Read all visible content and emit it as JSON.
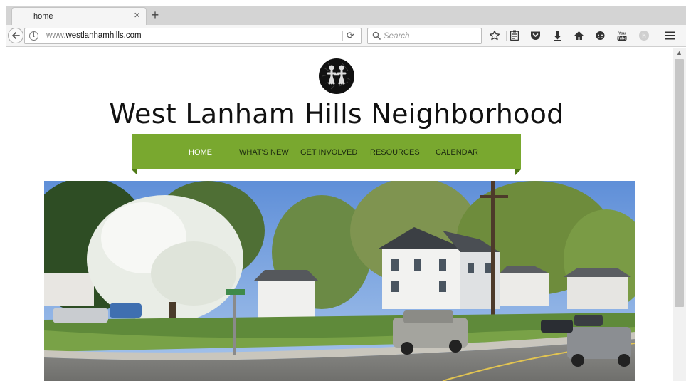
{
  "browser": {
    "tab": {
      "title": "home",
      "close": "×"
    },
    "new_tab": "+",
    "url": {
      "prefix": "www.",
      "domain": "westlanhamhills.com"
    },
    "search": {
      "placeholder": "Search"
    },
    "toolbar_icons": [
      "star-icon",
      "reading-list-icon",
      "pocket-icon",
      "download-icon",
      "home-icon",
      "chat-icon",
      "youtube-icon",
      "extension-icon",
      "menu-icon"
    ]
  },
  "site": {
    "title": "West Lanham Hills Neighborhood",
    "menu": [
      {
        "label": "HOME",
        "active": true
      },
      {
        "label": "WHAT'S NEW",
        "active": false
      },
      {
        "label": "GET INVOLVED",
        "active": false
      },
      {
        "label": "RESOURCES",
        "active": false
      },
      {
        "label": "CALENDAR",
        "active": false
      }
    ],
    "colors": {
      "menu_bg": "#79a82f",
      "menu_fold": "#4f7a16",
      "menu_active_text": "#ffffff"
    }
  }
}
